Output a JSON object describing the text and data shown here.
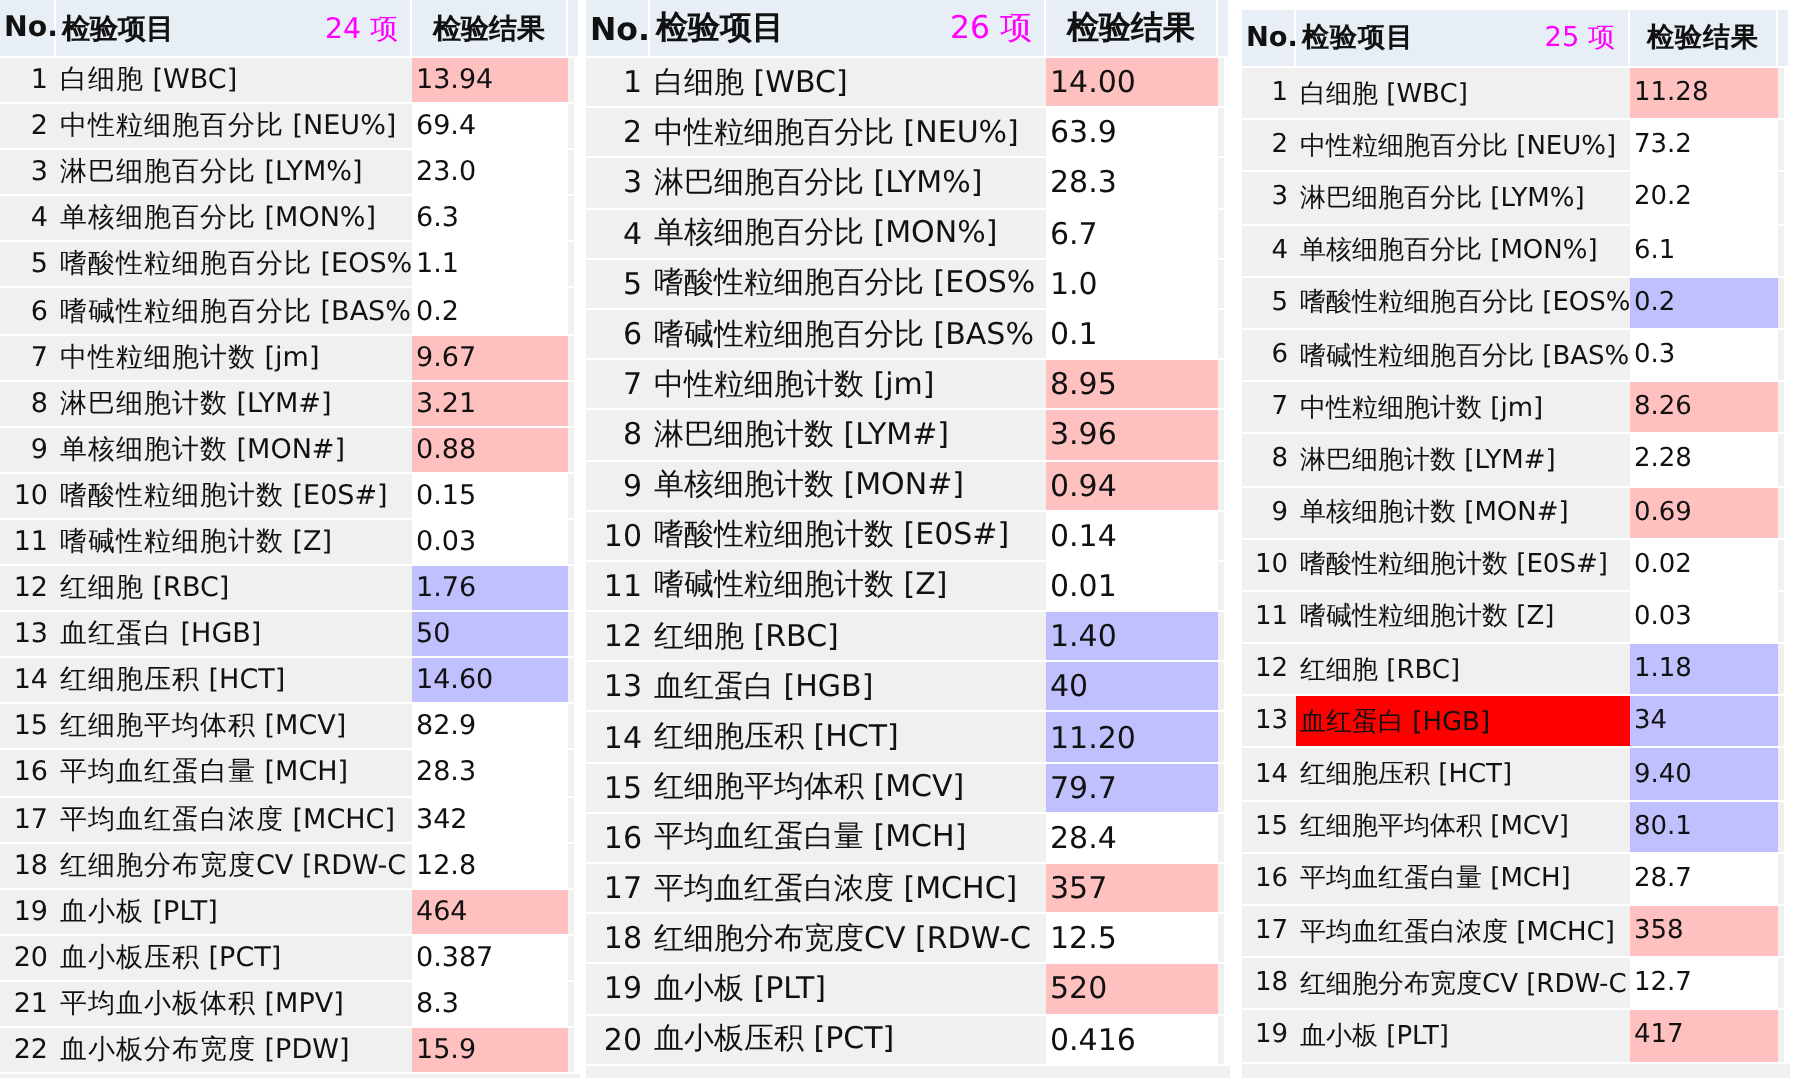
{
  "panels": [
    {
      "header": {
        "no": "No.",
        "item": "检验项目",
        "count": "24 项",
        "result": "检验结果"
      },
      "rows": [
        {
          "no": "1",
          "name": "白细胞 [WBC]",
          "name_alert": false,
          "result": "13.94",
          "high": true,
          "low": false
        },
        {
          "no": "2",
          "name": "中性粒细胞百分比 [NEU%]",
          "name_alert": false,
          "result": "69.4",
          "high": false,
          "low": false
        },
        {
          "no": "3",
          "name": "淋巴细胞百分比 [LYM%]",
          "name_alert": false,
          "result": "23.0",
          "high": false,
          "low": false
        },
        {
          "no": "4",
          "name": "单核细胞百分比 [MON%]",
          "name_alert": false,
          "result": "6.3",
          "high": false,
          "low": false
        },
        {
          "no": "5",
          "name": "嗜酸性粒细胞百分比 [EOS%",
          "name_alert": false,
          "result": "1.1",
          "high": false,
          "low": false
        },
        {
          "no": "6",
          "name": "嗜碱性粒细胞百分比 [BAS%",
          "name_alert": false,
          "result": "0.2",
          "high": false,
          "low": false
        },
        {
          "no": "7",
          "name": "中性粒细胞计数 [jm]",
          "name_alert": false,
          "result": "9.67",
          "high": true,
          "low": false
        },
        {
          "no": "8",
          "name": "淋巴细胞计数 [LYM#]",
          "name_alert": false,
          "result": "3.21",
          "high": true,
          "low": false
        },
        {
          "no": "9",
          "name": "单核细胞计数 [MON#]",
          "name_alert": false,
          "result": "0.88",
          "high": true,
          "low": false
        },
        {
          "no": "10",
          "name": "嗜酸性粒细胞计数 [E0S#]",
          "name_alert": false,
          "result": "0.15",
          "high": false,
          "low": false
        },
        {
          "no": "11",
          "name": "嗜碱性粒细胞计数 [Z]",
          "name_alert": false,
          "result": "0.03",
          "high": false,
          "low": false
        },
        {
          "no": "12",
          "name": "红细胞 [RBC]",
          "name_alert": false,
          "result": "1.76",
          "high": false,
          "low": true
        },
        {
          "no": "13",
          "name": "血红蛋白 [HGB]",
          "name_alert": false,
          "result": "50",
          "high": false,
          "low": true
        },
        {
          "no": "14",
          "name": "红细胞压积 [HCT]",
          "name_alert": false,
          "result": "14.60",
          "high": false,
          "low": true
        },
        {
          "no": "15",
          "name": "红细胞平均体积 [MCV]",
          "name_alert": false,
          "result": "82.9",
          "high": false,
          "low": false
        },
        {
          "no": "16",
          "name": "平均血红蛋白量 [MCH]",
          "name_alert": false,
          "result": "28.3",
          "high": false,
          "low": false
        },
        {
          "no": "17",
          "name": "平均血红蛋白浓度 [MCHC]",
          "name_alert": false,
          "result": "342",
          "high": false,
          "low": false
        },
        {
          "no": "18",
          "name": "红细胞分布宽度CV [RDW-C",
          "name_alert": false,
          "result": "12.8",
          "high": false,
          "low": false
        },
        {
          "no": "19",
          "name": "血小板 [PLT]",
          "name_alert": false,
          "result": "464",
          "high": true,
          "low": false
        },
        {
          "no": "20",
          "name": "血小板压积 [PCT]",
          "name_alert": false,
          "result": "0.387",
          "high": false,
          "low": false
        },
        {
          "no": "21",
          "name": "平均血小板体积 [MPV]",
          "name_alert": false,
          "result": "8.3",
          "high": false,
          "low": false
        },
        {
          "no": "22",
          "name": "血小板分布宽度 [PDW]",
          "name_alert": false,
          "result": "15.9",
          "high": true,
          "low": false
        }
      ]
    },
    {
      "header": {
        "no": "No.",
        "item": "检验项目",
        "count": "26 项",
        "result": "检验结果"
      },
      "rows": [
        {
          "no": "1",
          "name": "白细胞 [WBC]",
          "name_alert": false,
          "result": "14.00",
          "high": true,
          "low": false
        },
        {
          "no": "2",
          "name": "中性粒细胞百分比 [NEU%]",
          "name_alert": false,
          "result": "63.9",
          "high": false,
          "low": false
        },
        {
          "no": "3",
          "name": "淋巴细胞百分比 [LYM%]",
          "name_alert": false,
          "result": "28.3",
          "high": false,
          "low": false
        },
        {
          "no": "4",
          "name": "单核细胞百分比 [MON%]",
          "name_alert": false,
          "result": "6.7",
          "high": false,
          "low": false
        },
        {
          "no": "5",
          "name": "嗜酸性粒细胞百分比 [EOS%",
          "name_alert": false,
          "result": "1.0",
          "high": false,
          "low": false
        },
        {
          "no": "6",
          "name": "嗜碱性粒细胞百分比 [BAS%",
          "name_alert": false,
          "result": "0.1",
          "high": false,
          "low": false
        },
        {
          "no": "7",
          "name": "中性粒细胞计数 [jm]",
          "name_alert": false,
          "result": "8.95",
          "high": true,
          "low": false
        },
        {
          "no": "8",
          "name": "淋巴细胞计数 [LYM#]",
          "name_alert": false,
          "result": "3.96",
          "high": true,
          "low": false
        },
        {
          "no": "9",
          "name": "单核细胞计数 [MON#]",
          "name_alert": false,
          "result": "0.94",
          "high": true,
          "low": false
        },
        {
          "no": "10",
          "name": "嗜酸性粒细胞计数 [E0S#]",
          "name_alert": false,
          "result": "0.14",
          "high": false,
          "low": false
        },
        {
          "no": "11",
          "name": "嗜碱性粒细胞计数 [Z]",
          "name_alert": false,
          "result": "0.01",
          "high": false,
          "low": false
        },
        {
          "no": "12",
          "name": "红细胞 [RBC]",
          "name_alert": false,
          "result": "1.40",
          "high": false,
          "low": true
        },
        {
          "no": "13",
          "name": "血红蛋白 [HGB]",
          "name_alert": false,
          "result": "40",
          "high": false,
          "low": true
        },
        {
          "no": "14",
          "name": "红细胞压积 [HCT]",
          "name_alert": false,
          "result": "11.20",
          "high": false,
          "low": true
        },
        {
          "no": "15",
          "name": "红细胞平均体积 [MCV]",
          "name_alert": false,
          "result": "79.7",
          "high": false,
          "low": true
        },
        {
          "no": "16",
          "name": "平均血红蛋白量 [MCH]",
          "name_alert": false,
          "result": "28.4",
          "high": false,
          "low": false
        },
        {
          "no": "17",
          "name": "平均血红蛋白浓度 [MCHC]",
          "name_alert": false,
          "result": "357",
          "high": true,
          "low": false
        },
        {
          "no": "18",
          "name": "红细胞分布宽度CV [RDW-C",
          "name_alert": false,
          "result": "12.5",
          "high": false,
          "low": false
        },
        {
          "no": "19",
          "name": "血小板 [PLT]",
          "name_alert": false,
          "result": "520",
          "high": true,
          "low": false
        },
        {
          "no": "20",
          "name": "血小板压积 [PCT]",
          "name_alert": false,
          "result": "0.416",
          "high": false,
          "low": false
        }
      ]
    },
    {
      "header": {
        "no": "No.",
        "item": "检验项目",
        "count": "25 项",
        "result": "检验结果"
      },
      "rows": [
        {
          "no": "1",
          "name": "白细胞 [WBC]",
          "name_alert": false,
          "result": "11.28",
          "high": true,
          "low": false
        },
        {
          "no": "2",
          "name": "中性粒细胞百分比 [NEU%]",
          "name_alert": false,
          "result": "73.2",
          "high": false,
          "low": false
        },
        {
          "no": "3",
          "name": "淋巴细胞百分比 [LYM%]",
          "name_alert": false,
          "result": "20.2",
          "high": false,
          "low": false
        },
        {
          "no": "4",
          "name": "单核细胞百分比 [MON%]",
          "name_alert": false,
          "result": "6.1",
          "high": false,
          "low": false
        },
        {
          "no": "5",
          "name": "嗜酸性粒细胞百分比 [EOS%",
          "name_alert": false,
          "result": "0.2",
          "high": false,
          "low": true
        },
        {
          "no": "6",
          "name": "嗜碱性粒细胞百分比 [BAS%",
          "name_alert": false,
          "result": "0.3",
          "high": false,
          "low": false
        },
        {
          "no": "7",
          "name": "中性粒细胞计数 [jm]",
          "name_alert": false,
          "result": "8.26",
          "high": true,
          "low": false
        },
        {
          "no": "8",
          "name": "淋巴细胞计数 [LYM#]",
          "name_alert": false,
          "result": "2.28",
          "high": false,
          "low": false
        },
        {
          "no": "9",
          "name": "单核细胞计数 [MON#]",
          "name_alert": false,
          "result": "0.69",
          "high": true,
          "low": false
        },
        {
          "no": "10",
          "name": "嗜酸性粒细胞计数 [E0S#]",
          "name_alert": false,
          "result": "0.02",
          "high": false,
          "low": false
        },
        {
          "no": "11",
          "name": "嗜碱性粒细胞计数 [Z]",
          "name_alert": false,
          "result": "0.03",
          "high": false,
          "low": false
        },
        {
          "no": "12",
          "name": "红细胞 [RBC]",
          "name_alert": false,
          "result": "1.18",
          "high": false,
          "low": true
        },
        {
          "no": "13",
          "name": "血红蛋白 [HGB]",
          "name_alert": true,
          "result": "34",
          "high": false,
          "low": true
        },
        {
          "no": "14",
          "name": "红细胞压积 [HCT]",
          "name_alert": false,
          "result": "9.40",
          "high": false,
          "low": true
        },
        {
          "no": "15",
          "name": "红细胞平均体积 [MCV]",
          "name_alert": false,
          "result": "80.1",
          "high": false,
          "low": true
        },
        {
          "no": "16",
          "name": "平均血红蛋白量 [MCH]",
          "name_alert": false,
          "result": "28.7",
          "high": false,
          "low": false
        },
        {
          "no": "17",
          "name": "平均血红蛋白浓度 [MCHC]",
          "name_alert": false,
          "result": "358",
          "high": true,
          "low": false
        },
        {
          "no": "18",
          "name": "红细胞分布宽度CV [RDW-C",
          "name_alert": false,
          "result": "12.7",
          "high": false,
          "low": false
        },
        {
          "no": "19",
          "name": "血小板 [PLT]",
          "name_alert": false,
          "result": "417",
          "high": true,
          "low": false
        }
      ]
    }
  ]
}
